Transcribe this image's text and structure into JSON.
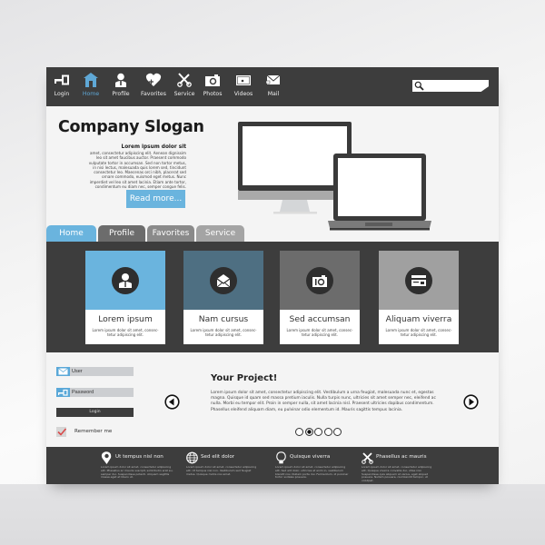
{
  "nav": {
    "items": [
      {
        "label": "Login",
        "icon": "key-icon"
      },
      {
        "label": "Home",
        "icon": "home-icon",
        "active": true
      },
      {
        "label": "Profile",
        "icon": "user-icon"
      },
      {
        "label": "Favorites",
        "icon": "heart-icon"
      },
      {
        "label": "Service",
        "icon": "wrench-screwdriver-icon"
      },
      {
        "label": "Photos",
        "icon": "camera-icon"
      },
      {
        "label": "Videos",
        "icon": "video-icon"
      },
      {
        "label": "Mail",
        "icon": "mail-icon"
      }
    ],
    "search_placeholder": ""
  },
  "hero": {
    "slogan": "Company Slogan",
    "subtitle": "Lorem ipsum dolor sit",
    "body": "amet, consectetur adipiscing elit. Aenean dignissim leo sit amet faucibus auctor. Praesent commodo vulputate tortor in accumsan. Sed non tortor metus, in nisi lectus, malesuada quis lorem sed, tincidunt consectetur leo. Maecenas orci nibh, placerat sed ornare commodo, euismod eget metus. Nunc imperdiet vel leo sit amet lacinia. Etiam ante tortor, condimentum eu diam nec, semper congue felis.",
    "read_more": "Read more..."
  },
  "tabs": [
    {
      "label": "Home",
      "active": true
    },
    {
      "label": "Profile"
    },
    {
      "label": "Favorites"
    },
    {
      "label": "Service"
    }
  ],
  "colors": {
    "accent": "#6ab4de",
    "dark": "#3d3d3d",
    "card_tops": [
      "#6ab4de",
      "#4e6f82",
      "#6c6c6c",
      "#a0a0a0"
    ]
  },
  "cards": [
    {
      "title": "Lorem ipsum",
      "desc": "Lorem ipsum dolor sit amet, consec-tetur adipiscing elit.",
      "icon": "user-icon"
    },
    {
      "title": "Nam cursus",
      "desc": "Lorem ipsum dolor sit amet, consec-tetur adipiscing elit.",
      "icon": "open-mail-icon"
    },
    {
      "title": "Sed accumsan",
      "desc": "Lorem ipsum dolor sit amet, consec-tetur adipiscing elit.",
      "icon": "camera-icon"
    },
    {
      "title": "Aliquam viverra",
      "desc": "Lorem ipsum dolor sit amet, consec-tetur adipiscing elit.",
      "icon": "credit-card-icon"
    }
  ],
  "login": {
    "user_placeholder": "User",
    "password_placeholder": "Password",
    "button": "Login",
    "remember": "Remember me",
    "remember_checked": true
  },
  "project": {
    "title": "Your Project!",
    "body": "Lorem ipsum dolor sit amet, consectetur adipiscing elit. Vestibulum a urna feugiat, malesuada nunc et, egestas magna. Quisque id quam sed massa pretium iaculis. Nulla turpis nunc, ultricies sit amet semper nec, eleifend ac nulla. Morbi eu tempor elit. Proin in semper nulla, sit amet lacinia nisl. Praesent ultricies dapibus condimentum. Phasellus eleifend aliquam diam, eu pulvinar odio elementum id. Mauris sagittis tempus lacinia.",
    "pagination": {
      "total": 5,
      "current": 2
    }
  },
  "footer": [
    {
      "title": "Ut tempus nisl non",
      "icon": "location-pin-icon",
      "body": "Lorem ipsum dolor sit amet, consectetur adipiscing elit. Phasellus ac mauris suscipit, sollicitudin erat eu, semper dui. Suspendisse potenti. Aliquam sagittis massa eget et libero ut."
    },
    {
      "title": "Sed elit dolor",
      "icon": "globe-icon",
      "body": "Lorem ipsum dolor sit amet, consectetur adipiscing elit. Ut tempus nisl non. Vestibulum sed feugiat metus. Quisque mollis nisi amet."
    },
    {
      "title": "Quisque viverra",
      "icon": "lightbulb-icon",
      "body": "Lorem ipsum dolor sit amet, consectetur adipiscing elit. Sed elit dolor, ultricies at enim in, vestibulum blandit nisi. Nullam porta dui. Fermentum, id pulvinar tortor sodales posuere."
    },
    {
      "title": "Phasellus ac mauris",
      "icon": "tools-icon",
      "body": "Lorem ipsum dolor sit amet, consectetur adipiscing elit. Quisque viverra convallis dui, vitae nisl. Suspendisse quis aliquam at varius, eget aliquet posuere. Nullam posuere, nisl blandit tempor, ut volutpat."
    }
  ]
}
